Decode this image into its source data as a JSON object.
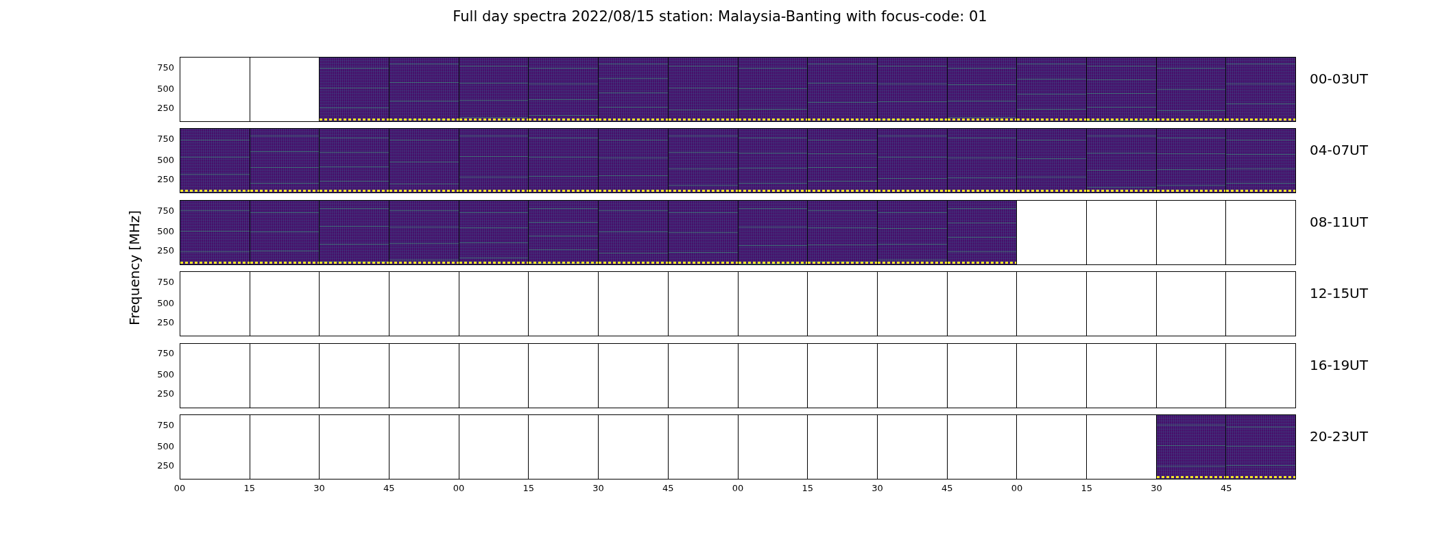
{
  "title": "Full day spectra 2022/08/15 station: Malaysia-Banting with focus-code: 01",
  "ylabel": "Frequency [MHz]",
  "rows": [
    {
      "label": "00-03UT",
      "yticks": [
        "750",
        "500",
        "250"
      ],
      "panels": [
        {
          "filled": false
        },
        {
          "filled": false
        },
        {
          "filled": true
        },
        {
          "filled": true
        },
        {
          "filled": true
        },
        {
          "filled": true
        },
        {
          "filled": true
        },
        {
          "filled": true
        },
        {
          "filled": true
        },
        {
          "filled": true
        },
        {
          "filled": true
        },
        {
          "filled": true
        },
        {
          "filled": true
        },
        {
          "filled": true
        },
        {
          "filled": true
        },
        {
          "filled": true
        }
      ]
    },
    {
      "label": "04-07UT",
      "yticks": [
        "750",
        "500",
        "250"
      ],
      "panels": [
        {
          "filled": true
        },
        {
          "filled": true
        },
        {
          "filled": true
        },
        {
          "filled": true
        },
        {
          "filled": true
        },
        {
          "filled": true
        },
        {
          "filled": true
        },
        {
          "filled": true
        },
        {
          "filled": true
        },
        {
          "filled": true
        },
        {
          "filled": true
        },
        {
          "filled": true
        },
        {
          "filled": true
        },
        {
          "filled": true
        },
        {
          "filled": true
        },
        {
          "filled": true
        }
      ]
    },
    {
      "label": "08-11UT",
      "yticks": [
        "750",
        "500",
        "250"
      ],
      "panels": [
        {
          "filled": true
        },
        {
          "filled": true
        },
        {
          "filled": true
        },
        {
          "filled": true
        },
        {
          "filled": true
        },
        {
          "filled": true
        },
        {
          "filled": true
        },
        {
          "filled": true
        },
        {
          "filled": true
        },
        {
          "filled": true
        },
        {
          "filled": true
        },
        {
          "filled": true
        },
        {
          "filled": false
        },
        {
          "filled": false
        },
        {
          "filled": false
        },
        {
          "filled": false
        }
      ]
    },
    {
      "label": "12-15UT",
      "yticks": [
        "750",
        "500",
        "250"
      ],
      "panels": [
        {
          "filled": false
        },
        {
          "filled": false
        },
        {
          "filled": false
        },
        {
          "filled": false
        },
        {
          "filled": false
        },
        {
          "filled": false
        },
        {
          "filled": false
        },
        {
          "filled": false
        },
        {
          "filled": false
        },
        {
          "filled": false
        },
        {
          "filled": false
        },
        {
          "filled": false
        },
        {
          "filled": false
        },
        {
          "filled": false
        },
        {
          "filled": false
        },
        {
          "filled": false
        }
      ]
    },
    {
      "label": "16-19UT",
      "yticks": [
        "750",
        "500",
        "250"
      ],
      "panels": [
        {
          "filled": false
        },
        {
          "filled": false
        },
        {
          "filled": false
        },
        {
          "filled": false
        },
        {
          "filled": false
        },
        {
          "filled": false
        },
        {
          "filled": false
        },
        {
          "filled": false
        },
        {
          "filled": false
        },
        {
          "filled": false
        },
        {
          "filled": false
        },
        {
          "filled": false
        },
        {
          "filled": false
        },
        {
          "filled": false
        },
        {
          "filled": false
        },
        {
          "filled": false
        }
      ]
    },
    {
      "label": "20-23UT",
      "yticks": [
        "750",
        "500",
        "250"
      ],
      "panels": [
        {
          "filled": false
        },
        {
          "filled": false
        },
        {
          "filled": false
        },
        {
          "filled": false
        },
        {
          "filled": false
        },
        {
          "filled": false
        },
        {
          "filled": false
        },
        {
          "filled": false
        },
        {
          "filled": false
        },
        {
          "filled": false
        },
        {
          "filled": false
        },
        {
          "filled": false
        },
        {
          "filled": false
        },
        {
          "filled": false
        },
        {
          "filled": true
        },
        {
          "filled": true
        }
      ]
    }
  ],
  "xticks": [
    "00",
    "15",
    "30",
    "45",
    "00",
    "15",
    "30",
    "45",
    "00",
    "15",
    "30",
    "45",
    "00",
    "15",
    "30",
    "45"
  ]
}
